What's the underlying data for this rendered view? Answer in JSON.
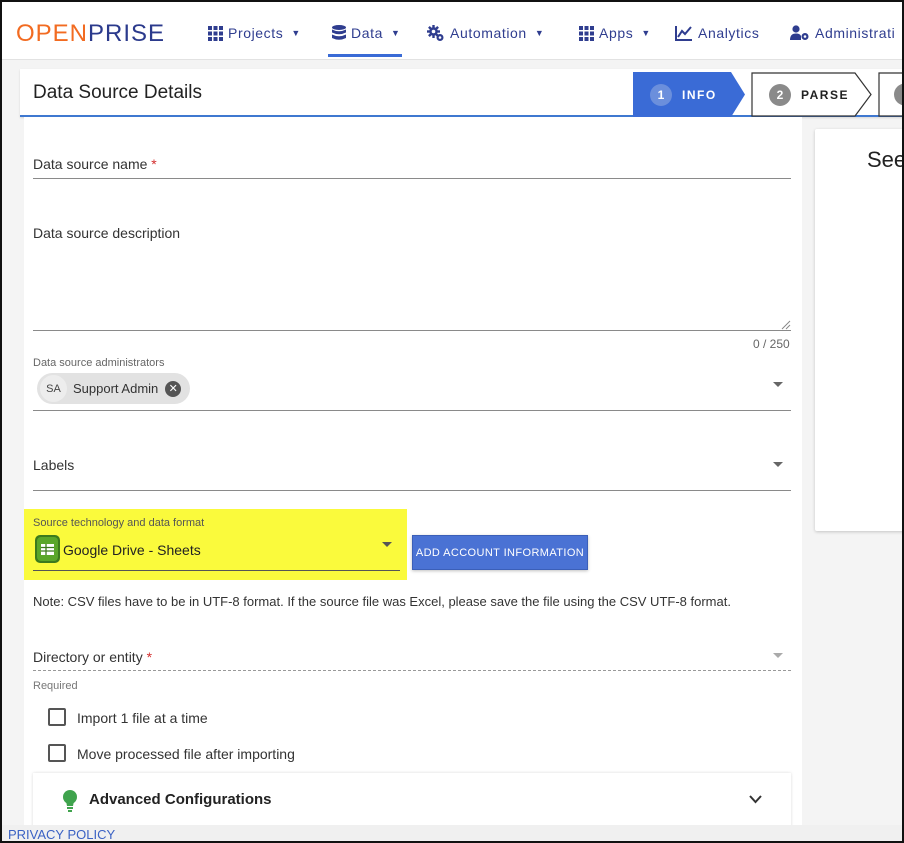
{
  "nav": {
    "logo_part1": "OPEN",
    "logo_part2": "PRISE",
    "items": [
      {
        "label": "Projects",
        "icon": "grid-icon"
      },
      {
        "label": "Data",
        "icon": "database-icon"
      },
      {
        "label": "Automation",
        "icon": "gears-icon"
      },
      {
        "label": "Apps",
        "icon": "grid-icon"
      },
      {
        "label": "Analytics",
        "icon": "chart-icon"
      },
      {
        "label": "Administrati",
        "icon": "user-gear-icon"
      }
    ]
  },
  "header": {
    "title": "Data Source Details",
    "steps": [
      {
        "num": "1",
        "label": "INFO"
      },
      {
        "num": "2",
        "label": "PARSE"
      }
    ]
  },
  "form": {
    "name_label": "Data source name",
    "required_mark": "*",
    "description_label": "Data source description",
    "description_counter": "0 / 250",
    "admins_label": "Data source administrators",
    "admin_chip_initials": "SA",
    "admin_chip_name": "Support Admin",
    "labels_label": "Labels",
    "source_tech_label": "Source technology and data format",
    "source_tech_value": "Google Drive - Sheets",
    "add_account_button": "ADD ACCOUNT INFORMATION",
    "note": "Note: CSV files have to be in UTF-8 format. If the source file was Excel, please save the file using the CSV UTF-8 format.",
    "directory_label": "Directory or entity",
    "directory_hint": "Required",
    "checkbox_import_one": "Import 1 file at a time",
    "checkbox_move_processed": "Move processed file after importing",
    "advanced_title": "Advanced Configurations"
  },
  "side_panel": {
    "title_partial": "See"
  },
  "footer": {
    "privacy": "PRIVACY POLICY"
  },
  "colors": {
    "accent": "#3a6bd6",
    "logo_orange": "#f26b21",
    "logo_navy": "#2b3a8c",
    "highlight": "#fafa3c",
    "required": "#d32f2f"
  }
}
